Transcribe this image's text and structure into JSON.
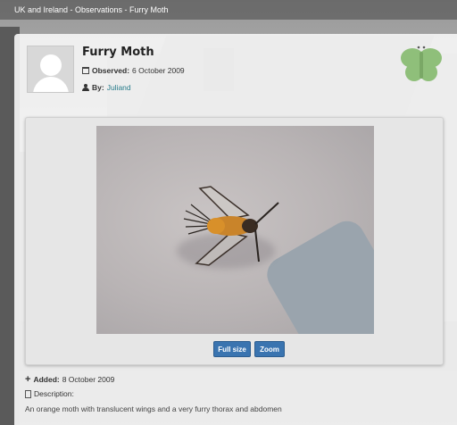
{
  "header": {
    "breadcrumb": "UK and Ireland - Observations - Furry Moth"
  },
  "observation": {
    "title": "Furry Moth",
    "observed_label": "Observed:",
    "observed_date": "6 October 2009",
    "by_label": "By:",
    "by_user": "Juliand",
    "added_label": "Added:",
    "added_date": "8 October 2009",
    "description_label": "Description:",
    "description": "An orange moth with translucent wings and a very furry thorax and abdomen"
  },
  "buttons": {
    "full_size": "Full size",
    "zoom": "Zoom"
  },
  "colors": {
    "accent_button": "#3a74b0",
    "link": "#2a7d8c",
    "logo_green": "#8fbf7a"
  },
  "icons": [
    "calendar-icon",
    "user-icon",
    "plus-icon",
    "document-icon",
    "butterfly-logo"
  ]
}
